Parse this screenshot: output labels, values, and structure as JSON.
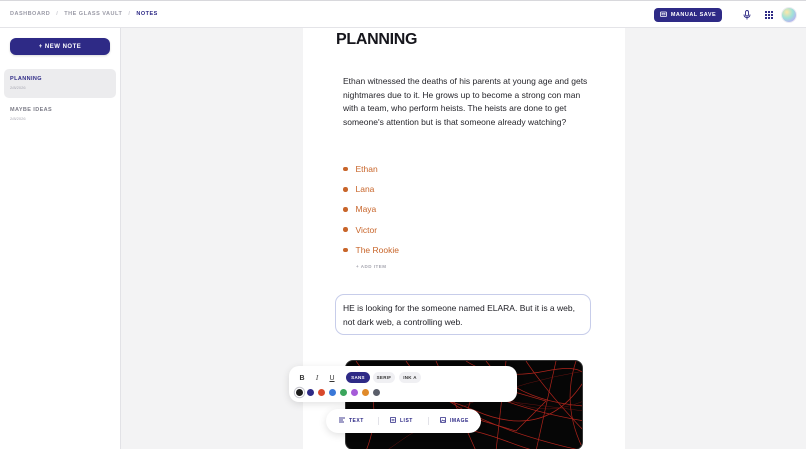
{
  "breadcrumb": {
    "items": [
      "DASHBOARD",
      "THE GLASS VAULT"
    ],
    "current": "NOTES",
    "separator": "/"
  },
  "header": {
    "manual_save_label": "MANUAL SAVE",
    "icons": [
      "folder-icon",
      "mic-icon",
      "grid-icon",
      "avatar"
    ]
  },
  "sidebar": {
    "new_note_label": "+ NEW NOTE",
    "notes": [
      {
        "title": "PLANNING",
        "date": "2/8/2026",
        "active": true
      },
      {
        "title": "MAYBE IDEAS",
        "date": "2/8/2026",
        "active": false
      }
    ]
  },
  "editor": {
    "title": "PLANNING",
    "paragraph": "Ethan witnessed the deaths of his parents at young age and gets nightmares due to it. He grows up to become a strong con man with a team, who perform heists. The heists are done to get someone's attention but is that someone already watching?",
    "list_items": [
      "Ethan",
      "Lana",
      "Maya",
      "Victor",
      "The Rookie"
    ],
    "add_item_label": "+ ADD ITEM",
    "callout": "HE is looking for the someone named ELARA. But it is a web, not dark web, a controlling web."
  },
  "format_toolbar": {
    "bold": "B",
    "italic": "I",
    "underline": "U",
    "fonts": [
      {
        "label": "SANS",
        "active": true
      },
      {
        "label": "SERIF",
        "active": false
      },
      {
        "label": "INK A",
        "active": false
      }
    ],
    "colors": [
      "#1c1c1c",
      "#2e2a86",
      "#d8492c",
      "#3a78d8",
      "#3aa55c",
      "#a55bd8",
      "#e08a2a",
      "#5a5e6a"
    ],
    "selected_color": "#1c1c1c"
  },
  "insert_bar": {
    "text_label": "TEXT",
    "list_label": "LIST",
    "image_label": "IMAGE"
  },
  "colors": {
    "accent": "#2e2a86",
    "list_text": "#c8652a",
    "callout_border": "#c7cdea",
    "background": "#f3f3f4"
  }
}
